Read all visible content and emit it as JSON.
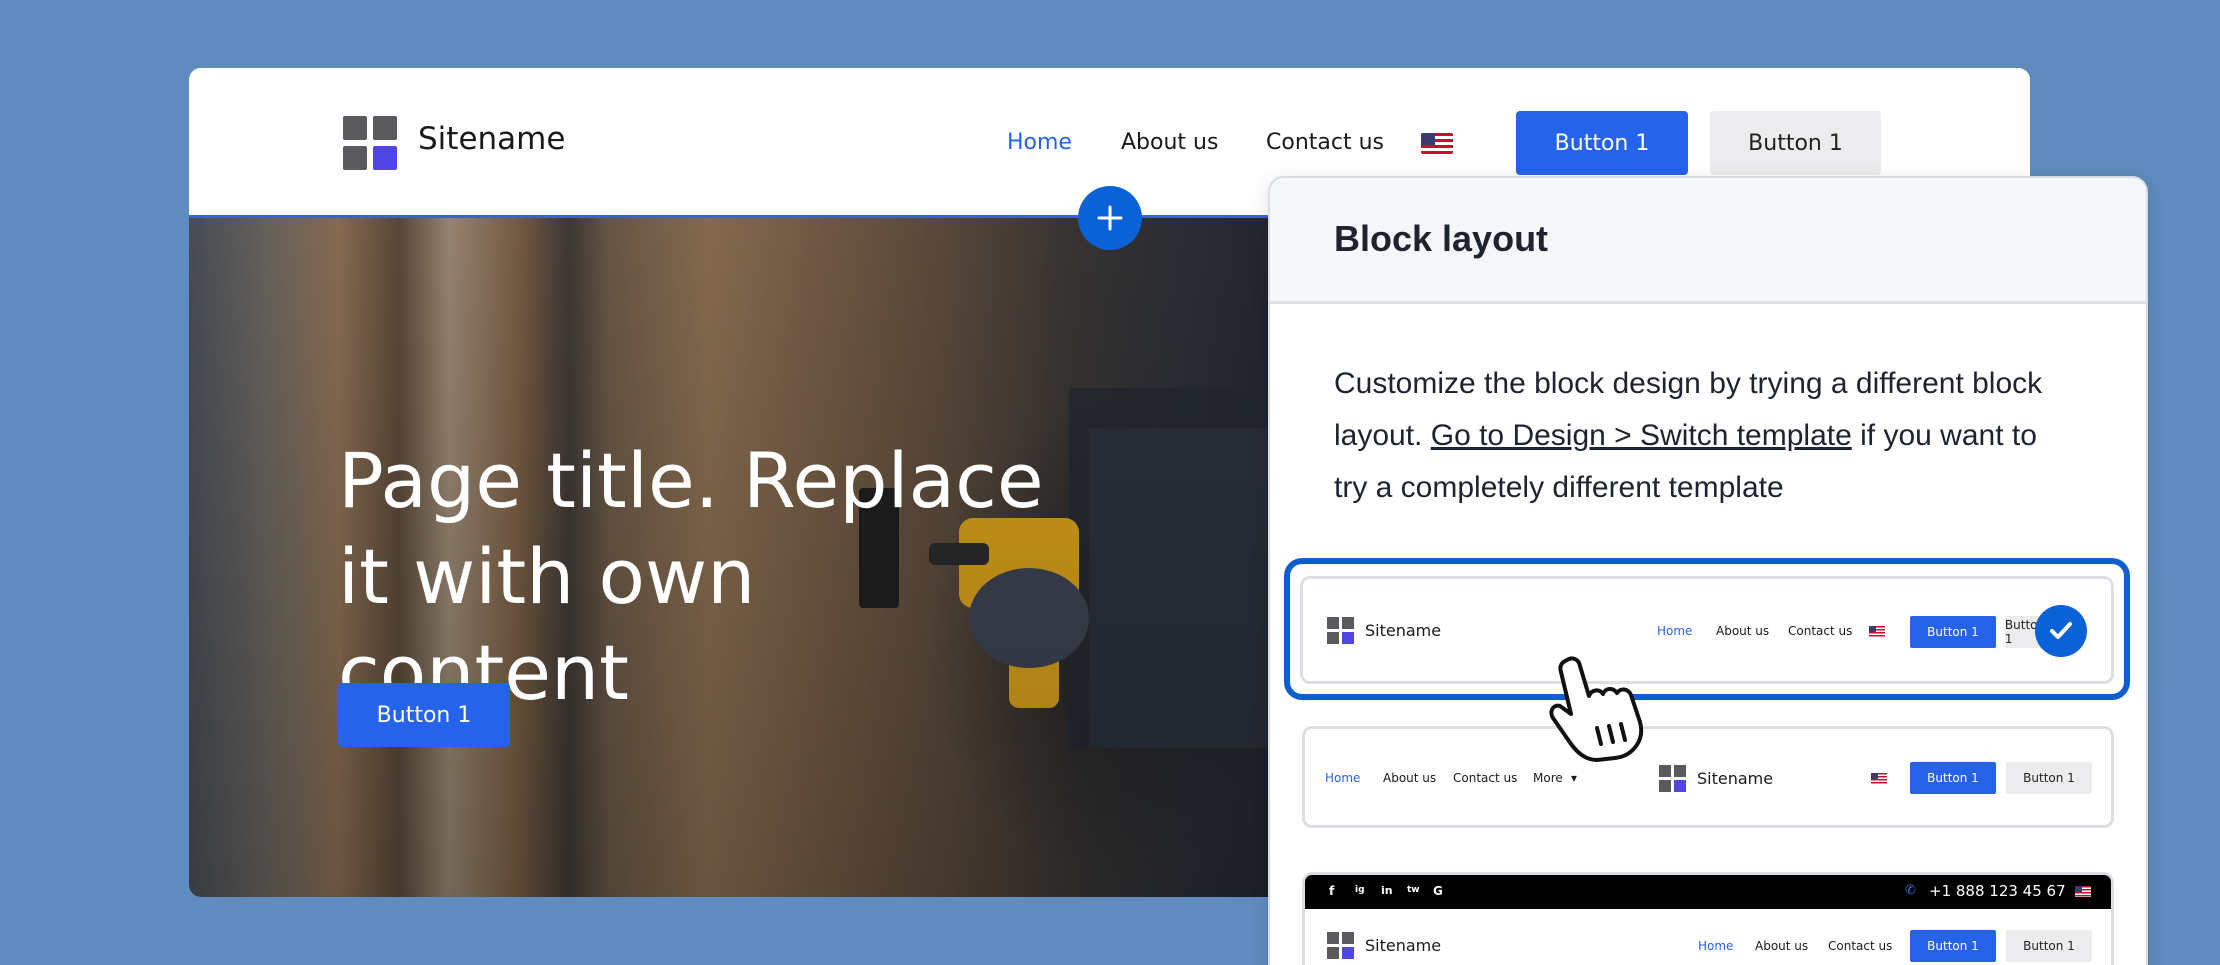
{
  "site": {
    "name": "Sitename",
    "nav": [
      "Home",
      "About us",
      "Contact us"
    ],
    "button_primary": "Button 1",
    "button_secondary": "Button 1"
  },
  "hero": {
    "title": "Page title. Replace it with own content",
    "button": "Button 1"
  },
  "panel": {
    "title": "Block layout",
    "description_before": "Customize the block design by trying a different block layout. ",
    "link": "Go to Design > Switch template",
    "description_after": " if you want to try a completely different template"
  },
  "options": [
    {
      "sitename": "Sitename",
      "nav": [
        "Home",
        "About us",
        "Contact us"
      ],
      "button_primary": "Button 1",
      "button_secondary": "Button 1",
      "selected": true
    },
    {
      "sitename": "Sitename",
      "nav": [
        "Home",
        "About us",
        "Contact us",
        "More"
      ],
      "button_primary": "Button 1",
      "button_secondary": "Button 1",
      "selected": false
    },
    {
      "sitename": "Sitename",
      "social": [
        "f",
        "ig",
        "in",
        "tw",
        "G"
      ],
      "phone": "+1 888 123 45 67",
      "nav": [
        "Home",
        "About us",
        "Contact us"
      ],
      "button_primary": "Button 1",
      "button_secondary": "Button 1",
      "selected": false
    }
  ],
  "colors": {
    "background": "#5f8bbf",
    "accent": "#2563eb",
    "selection": "#0b5fd0"
  },
  "icons": [
    "add-icon",
    "check-icon",
    "hand-cursor-icon",
    "us-flag-icon",
    "phone-icon"
  ]
}
